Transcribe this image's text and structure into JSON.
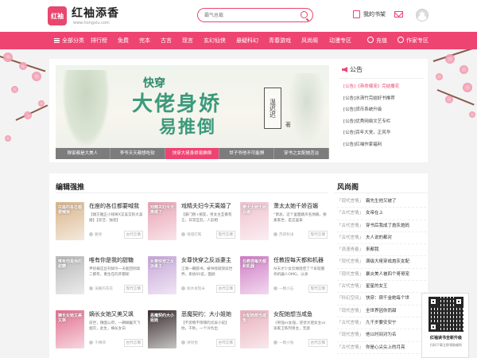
{
  "header": {
    "logo_mark": "红袖",
    "logo_name": "红袖添香",
    "logo_url": "www.hongxiu.com",
    "search_placeholder": "霸气总裁",
    "shelf_label": "我的书架"
  },
  "nav": {
    "items": [
      "全部分类",
      "排行榜",
      "免费",
      "完本",
      "古言",
      "现言",
      "玄幻仙侠",
      "悬疑科幻",
      "青春游戏",
      "风尚阁",
      "动漫专区",
      "充值",
      "作家专区"
    ]
  },
  "banner": {
    "small_text": "快穿",
    "big_text_1": "大佬身娇",
    "big_text_2": "易推倒",
    "author": "温迟迟",
    "author_suffix": "著",
    "tabs": [
      "穆家都是大美人",
      "李爷天天都想吃软",
      "快穿大佬身娇易推倒",
      "世子爷他不可能惧",
      "穿书之女配她恋淡"
    ]
  },
  "notice": {
    "title": "公告",
    "items": [
      {
        "text": "[公告]《恭命偏宠》完结撒花",
        "hot": true
      },
      {
        "text": "[公告]水清竹完结好书推荐",
        "hot": false
      },
      {
        "text": "[公告]货币系统升级",
        "hot": false
      },
      {
        "text": "[公告]优秀网络文艺专栏",
        "hot": false
      },
      {
        "text": "[公告]百年大党，正风华",
        "hot": false
      },
      {
        "text": "[公告]红袖作家福利",
        "hot": false
      }
    ]
  },
  "recommend": {
    "title": "编辑强推",
    "books": [
      {
        "title": "在座的各位都要喊我",
        "desc": "【端方雅正小钱将X又美又狗大美娘】【双洁、独宠】",
        "author": "路修",
        "category": "古代言情",
        "cover_color": "#d9b48a",
        "cover_text": "在座的各位都要喊我"
      },
      {
        "title": "戏精夫妇今天离婚了",
        "desc": "【豪门替+朋友，男女主互撕有言，日常互怼，人前相",
        "author": "诸城打盹",
        "category": "现代言情",
        "cover_color": "#e9a3b4",
        "cover_text": "戏精夫妇今天离婚了"
      },
      {
        "title": "萧太太她千娇百媚",
        "desc": "“萧总，这个里面跳声名地眼，要素家世，是这里拿",
        "author": "苏寂秋浅",
        "category": "现代言情",
        "cover_color": "#f0c2d0",
        "cover_text": "萧太太她千娇百媚"
      },
      {
        "title": "唯有你是我的甜糖",
        "desc": "尹初被这丝刊如今一天能回到高二那年，重生在的开都呢",
        "author": "溪眠的花花",
        "category": "现代言情",
        "cover_color": "#b9b9b9",
        "cover_text": "唯有你是我的甜糖"
      },
      {
        "title": "女尊快穿之反派妻主",
        "desc": "江谢一朝醉书，被书找就快穿世界，系统00说，面颜",
        "author": "桃木发现米",
        "category": "古代言情",
        "cover_color": "#c7a6d9",
        "cover_text": "女尊快穿之反派妻主"
      },
      {
        "title": "任教捏每天都和机器",
        "desc": "AI天才少女云缘连佳了个军就服务机器人OMG，以承",
        "author": "一颗小石",
        "category": "现代言情",
        "cover_color": "#d07cc5",
        "cover_text": "任教捏每天都和机器"
      },
      {
        "title": "嫡长女她又美又飒",
        "desc": "前世，镇国公府，一朝嫡屠灭飞烟灭，此生，嫡长女白",
        "author": "千樽邪",
        "category": "古代言情",
        "cover_color": "#e27090",
        "cover_text": "嫡长女她又美又飒"
      },
      {
        "title": "恶魔契约：大小姐她",
        "desc": "【不思悔不惊悚的灵异小说】他，干秋，一个冷负出",
        "author": "讲悦悦",
        "category": "古代言情",
        "cover_color": "#3a2e30",
        "cover_text": "恶魔契约大小姐她"
      },
      {
        "title": "女配她想当咸鱼",
        "desc": "《男强vs女强，逆伏大佬女主vs滚家卫系列男主，无虐",
        "author": "一颗小兔",
        "category": "古代言情",
        "cover_color": "#e9b0bd",
        "cover_text": "女配她想当咸鱼"
      }
    ]
  },
  "wind": {
    "title": "风尚阁",
    "items": [
      {
        "tag": "「现代言情」",
        "text": "霸先生他又被了"
      },
      {
        "tag": "「古代言情」",
        "text": "女帝在上"
      },
      {
        "tag": "「古代言情」",
        "text": "穿书后我成了炮灰炮妈"
      },
      {
        "tag": "「古代言情」",
        "text": "夫人说的都对"
      },
      {
        "tag": "「浪漫青春」",
        "text": "来都我"
      },
      {
        "tag": "「现代言情」",
        "text": "满级大佬穿成炮灰女配"
      },
      {
        "tag": "「现代言情」",
        "text": "暴炎美人被四个哥哥宠"
      },
      {
        "tag": "「古代言情」",
        "text": "星星的女王"
      },
      {
        "tag": "「科幻空间」",
        "text": "快穿：宿千金她每个世"
      },
      {
        "tag": "「现代言情」",
        "text": "全世界因你而甜"
      },
      {
        "tag": "「古代言情」",
        "text": "九千岁要安安宁"
      },
      {
        "tag": "「现代言情」",
        "text": "他以时间对为名"
      },
      {
        "tag": "「古代言情」",
        "text": "你是心尖尖上的月亮"
      }
    ]
  },
  "qr": {
    "title": "红袖读书全新升级",
    "subtitle": "扫码下载立即领取福利"
  },
  "colors": {
    "brand": "#ee4472",
    "nav": "#ee4472"
  }
}
